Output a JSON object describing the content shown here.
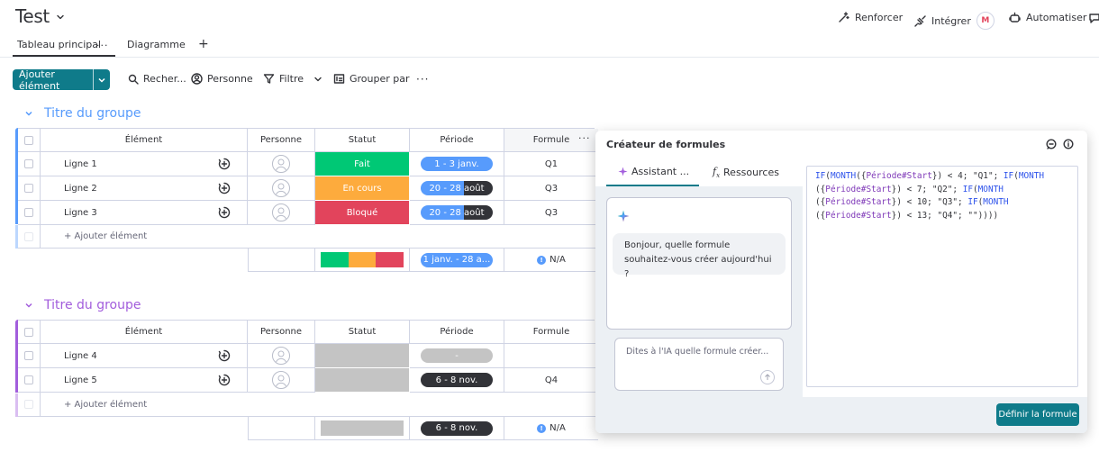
{
  "header": {
    "board_title": "Test",
    "actions": {
      "boost": "Renforcer",
      "integrate": "Intégrer",
      "automate": "Automatiser"
    },
    "tabs": {
      "main_table": "Tableau principal",
      "chart": "Diagramme"
    }
  },
  "toolbar": {
    "add_item": "Ajouter élément",
    "search": "Recher...",
    "person": "Personne",
    "filter": "Filtre",
    "group_by": "Grouper par"
  },
  "columns": {
    "element": "Élément",
    "person": "Personne",
    "status": "Statut",
    "period": "Période",
    "formula": "Formule"
  },
  "groups": [
    {
      "title": "Titre du groupe",
      "color": "#579bfc",
      "rows": [
        {
          "name": "Ligne 1",
          "status": "Fait",
          "status_color": "#00c875",
          "period": "1 - 3 janv.",
          "period_progress_pct": 100,
          "formula": "Q1"
        },
        {
          "name": "Ligne 2",
          "status": "En cours",
          "status_color": "#fdab3d",
          "period": "20 - 28 août",
          "period_progress_pct": 60,
          "formula": "Q3"
        },
        {
          "name": "Ligne 3",
          "status": "Bloqué",
          "status_color": "#e2445c",
          "period": "20 - 28 août",
          "period_progress_pct": 60,
          "formula": "Q3"
        }
      ],
      "add_label": "+ Ajouter élément",
      "summary": {
        "period": "1 janv. - 28 a...",
        "formula": "N/A",
        "status_colors": [
          "#00c875",
          "#fdab3d",
          "#e2445c"
        ]
      }
    },
    {
      "title": "Titre du groupe",
      "color": "#a25ddc",
      "rows": [
        {
          "name": "Ligne 4",
          "status": "",
          "status_color": "#c4c4c4",
          "period": "-",
          "period_progress_pct": 0,
          "formula": ""
        },
        {
          "name": "Ligne 5",
          "status": "",
          "status_color": "#c4c4c4",
          "period": "6 - 8 nov.",
          "period_progress_pct": 0,
          "formula": "Q4"
        }
      ],
      "add_label": "+ Ajouter élément",
      "summary": {
        "period": "6 - 8 nov.",
        "formula": "N/A"
      }
    }
  ],
  "formula_panel": {
    "title": "Créateur de formules",
    "tabs": {
      "assistant": "Assistant ...",
      "resources": "Ressources"
    },
    "assistant_greeting": "Bonjour, quelle formule souhaitez-vous créer aujourd'hui ?",
    "input_placeholder": "Dites à l'IA quelle formule créer...",
    "formula_text": "IF(MONTH({Période#Start}) < 4; \"Q1\"; IF(MONTH({Période#Start}) < 7; \"Q2\"; IF(MONTH({Période#Start}) < 10; \"Q3\"; IF(MONTH({Période#Start}) < 13; \"Q4\"; \"\"))))",
    "define_button": "Définir la formule"
  },
  "colors": {
    "accent": "#0f7b8a",
    "group1": "#579bfc",
    "group2": "#a25ddc",
    "period_blue": "#579bfc",
    "period_dark": "#323338"
  }
}
